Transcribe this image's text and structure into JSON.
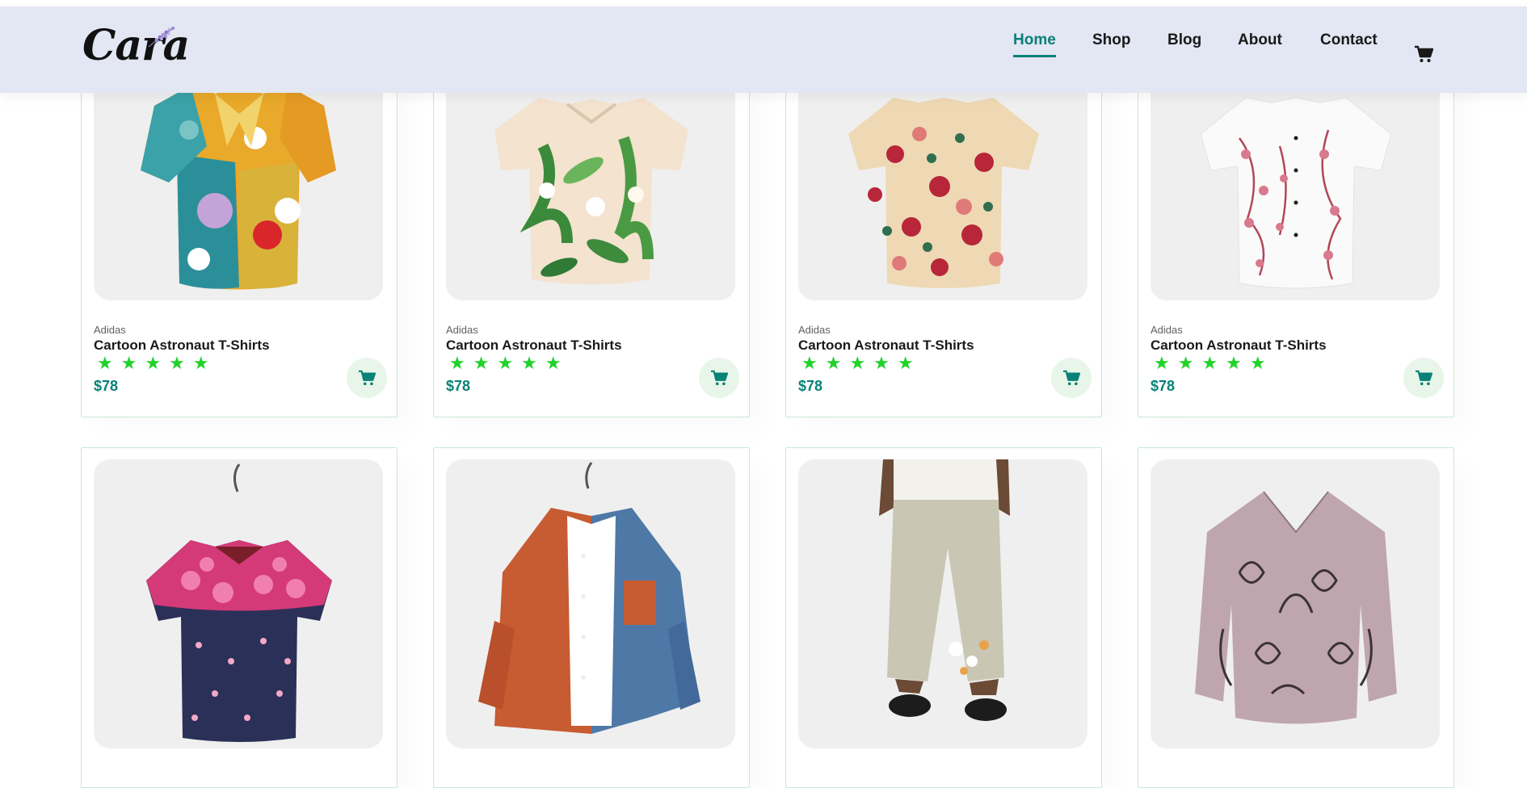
{
  "header": {
    "logo_text": "Cara",
    "nav": [
      {
        "label": "Home",
        "active": true
      },
      {
        "label": "Shop",
        "active": false
      },
      {
        "label": "Blog",
        "active": false
      },
      {
        "label": "About",
        "active": false
      },
      {
        "label": "Contact",
        "active": false
      }
    ],
    "cart_icon": "cart-icon"
  },
  "colors": {
    "accent": "#088178",
    "header_bg": "#e3e6f3",
    "star": "#22d12a",
    "cart_btn_bg": "#e8f6ea"
  },
  "products": [
    {
      "brand": "Adidas",
      "name": "Cartoon Astronaut T-Shirts",
      "stars": "★★★★★",
      "price": "$78",
      "image": "multicolor-floral-shirt"
    },
    {
      "brand": "Adidas",
      "name": "Cartoon Astronaut T-Shirts",
      "stars": "★★★★★",
      "price": "$78",
      "image": "cream-leaf-print-shirt"
    },
    {
      "brand": "Adidas",
      "name": "Cartoon Astronaut T-Shirts",
      "stars": "★★★★★",
      "price": "$78",
      "image": "beige-rose-print-shirt"
    },
    {
      "brand": "Adidas",
      "name": "Cartoon Astronaut T-Shirts",
      "stars": "★★★★★",
      "price": "$78",
      "image": "white-cherry-blossom-shirt"
    },
    {
      "image": "navy-floral-shirt"
    },
    {
      "image": "orange-blue-corduroy-shirt"
    },
    {
      "image": "linen-floral-pants"
    },
    {
      "image": "mauve-cat-print-blouse"
    }
  ]
}
